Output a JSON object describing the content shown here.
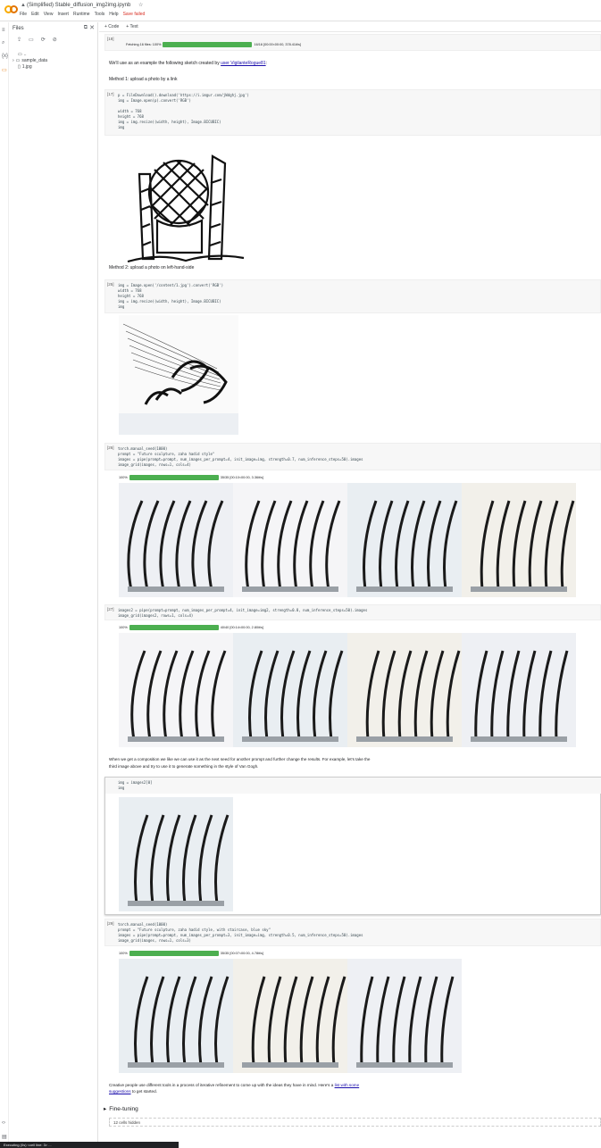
{
  "app": {
    "title": "(Simplified) Stable_diffusion_img2img.ipynb",
    "menu": [
      "File",
      "Edit",
      "View",
      "Insert",
      "Runtime",
      "Tools",
      "Help"
    ],
    "save_status": "Save failed"
  },
  "files_panel": {
    "title": "Files",
    "tree": [
      "..",
      "sample_data",
      "1.jpg"
    ]
  },
  "toolbar": {
    "code_label": "+ Code",
    "text_label": "+ Text"
  },
  "cells": {
    "c0": {
      "prompt": "[18]",
      "progress_label": "Fetching 16 files: 100%",
      "progress_pct": 100,
      "progress_stats": "16/16 [00:00<00:00, 378.41it/s]"
    },
    "text1": {
      "before": "We'll use as an example the following sketch created by ",
      "link": "user VigilanteRogue81",
      "after": ":"
    },
    "text2": "Method 1: upload a photo by a link",
    "c1": {
      "prompt": "[17]",
      "lines": [
        "p = FileDownload().download('https://i.imgur.com/jWdghj.jpg')",
        "img = Image.open(p).convert('RGB')",
        "",
        "width = 768",
        "height = 768",
        "img = img.resize((width, height), Image.BICUBIC)",
        "img"
      ]
    },
    "text3": "Method 2: upload a photo on left-hand-side",
    "c2": {
      "prompt": "[25]",
      "lines": [
        "img = Image.open('/content/1.jpg').convert('RGB')",
        "width = 768",
        "height = 768",
        "img = img.resize((width, height), Image.BICUBIC)",
        "img"
      ]
    },
    "c3": {
      "prompt": "[26]",
      "lines": [
        "torch.manual_seed(1000)",
        "prompt = \"Future sculpture, zaha hadid style\"",
        "images = pipe(prompt=prompt, num_images_per_prompt=4, init_image=img, strength=0.7, num_inference_steps=50).images",
        "image_grid(images, rows=1, cols=4)"
      ],
      "progress_label": "100%",
      "progress_pct": 100,
      "progress_stats": "35/35 [00:10<00:00, 3.36it/s]"
    },
    "c4": {
      "prompt": "[27]",
      "lines": [
        "images2 = pipe(prompt=prompt, num_images_per_prompt=4, init_image=img2, strength=0.8, num_inference_steps=50).images",
        "image_grid(images2, rows=1, cols=4)"
      ],
      "progress_label": "100%",
      "progress_pct": 100,
      "progress_stats": "40/40 [00:14<00:00, 2.80it/s]"
    },
    "text4": "When we get a composition we like we can use it as the next seed for another prompt and further change the results. For example, let's take the",
    "text4b": "third image above and try to use it to generate something in the style of Van Gogh.",
    "c5": {
      "prompt": "▶",
      "lines": [
        "img = images2[0]",
        "img"
      ]
    },
    "c6": {
      "prompt": "[29]",
      "lines": [
        "torch.manual_seed(1000)",
        "prompt = \"Future sculpture, zaha hadid style, with staircase, blue sky\"",
        "images = pipe(prompt=prompt, num_images_per_prompt=3, init_image=img, strength=0.5, num_inference_steps=50).images",
        "image_grid(images, rows=1, cols=3)"
      ],
      "progress_label": "100%",
      "progress_pct": 100,
      "progress_stats": "35/35 [00:07<00:00, 4.78it/s]"
    },
    "text5": {
      "before": "Creative people use different tools in a process of iterative refinement to come up with the ideas they have in mind. Here's a ",
      "link": "list with some",
      "link2": "suggestions",
      "after": " to get started."
    },
    "section": "Fine-tuning",
    "hidden": "12 cells hidden"
  },
  "status": "Executing (0s) <cell line: 3> ..."
}
